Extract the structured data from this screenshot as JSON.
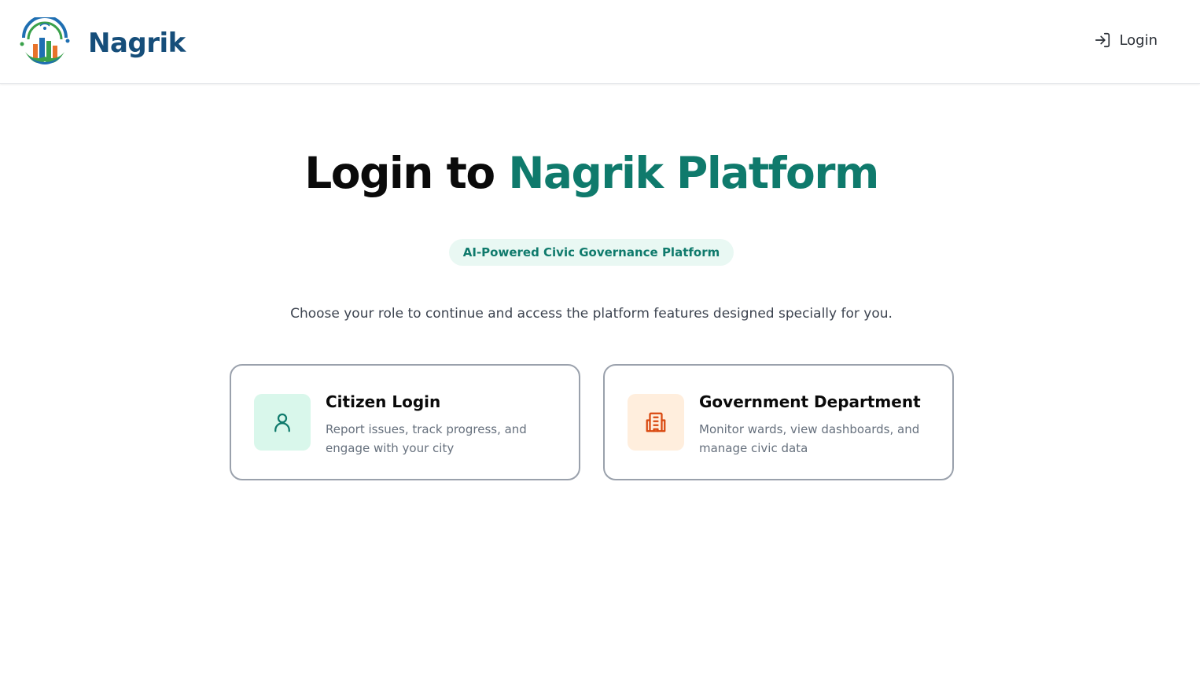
{
  "header": {
    "brand_name": "Nagrik",
    "login_label": "Login"
  },
  "hero": {
    "title_prefix": "Login to",
    "title_accent": "Nagrik Platform",
    "tagline": "AI-Powered Civic Governance Platform",
    "subtitle": "Choose your role to continue and access the platform features designed specially for you."
  },
  "cards": [
    {
      "title": "Citizen Login",
      "description": "Report issues, track progress, and engage with your city",
      "icon": "user-icon"
    },
    {
      "title": "Government Department",
      "description": "Monitor wards, view dashboards, and manage civic data",
      "icon": "building-icon"
    }
  ],
  "colors": {
    "brand_blue": "#164e7a",
    "accent_teal": "#0f7a6c",
    "citizen_icon_bg": "#d9f7eb",
    "gov_icon_bg": "#ffeedd",
    "gov_icon": "#d9480f"
  }
}
